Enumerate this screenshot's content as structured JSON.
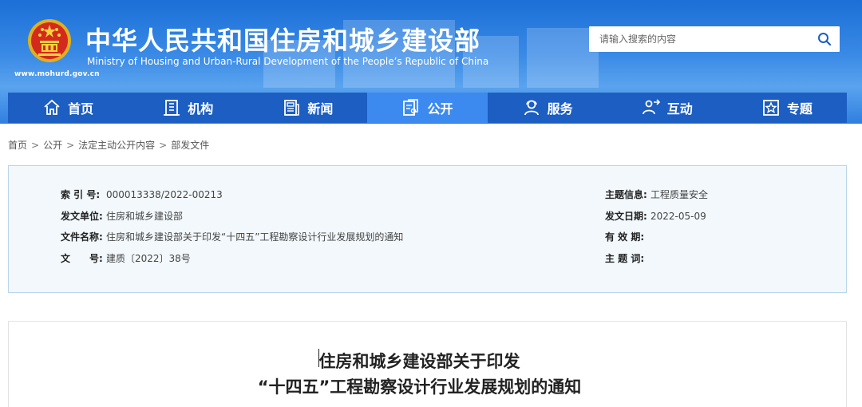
{
  "header": {
    "site_name_cn": "中华人民共和国住房和城乡建设部",
    "site_name_en": "Ministry of Housing and Urban-Rural Development of the People’s Republic of China",
    "site_url": "www.mohurd.gov.cn",
    "emblem_icon": "national-emblem-icon",
    "search": {
      "placeholder": "请输入搜索的内容",
      "icon": "search-icon"
    }
  },
  "nav": {
    "items": [
      {
        "label": "首页",
        "icon": "home-icon",
        "active": false
      },
      {
        "label": "机构",
        "icon": "building-icon",
        "active": false
      },
      {
        "label": "新闻",
        "icon": "news-icon",
        "active": false
      },
      {
        "label": "公开",
        "icon": "document-icon",
        "active": true
      },
      {
        "label": "服务",
        "icon": "service-icon",
        "active": false
      },
      {
        "label": "互动",
        "icon": "interaction-icon",
        "active": false
      },
      {
        "label": "专题",
        "icon": "star-icon",
        "active": false
      }
    ]
  },
  "breadcrumb": {
    "items": [
      "首页",
      "公开",
      "法定主动公开内容",
      "部发文件"
    ],
    "separator": ">"
  },
  "info": {
    "left": [
      {
        "label": "索 引 号:",
        "value": "000013338/2022-00213"
      },
      {
        "label": "发文单位:",
        "value": "住房和城乡建设部"
      },
      {
        "label": "文件名称:",
        "value": "住房和城乡建设部关于印发“十四五”工程勘察设计行业发展规划的通知"
      },
      {
        "label": "文　　号:",
        "value": "建质〔2022〕38号"
      }
    ],
    "right": [
      {
        "label": "主题信息:",
        "value": "工程质量安全"
      },
      {
        "label": "发文日期:",
        "value": "2022-05-09"
      },
      {
        "label": "有 效 期:",
        "value": ""
      },
      {
        "label": "主 题 词:",
        "value": ""
      }
    ]
  },
  "document": {
    "title_line1": "住房和城乡建设部关于印发",
    "title_line2": "“十四五”工程勘察设计行业发展规划的通知"
  },
  "colors": {
    "header_blue": "#2f7fe0",
    "nav_blue": "#1c5ec2",
    "nav_active": "#3c8af0",
    "info_bg": "#f2f8fc",
    "info_border": "#b9d6ea"
  }
}
